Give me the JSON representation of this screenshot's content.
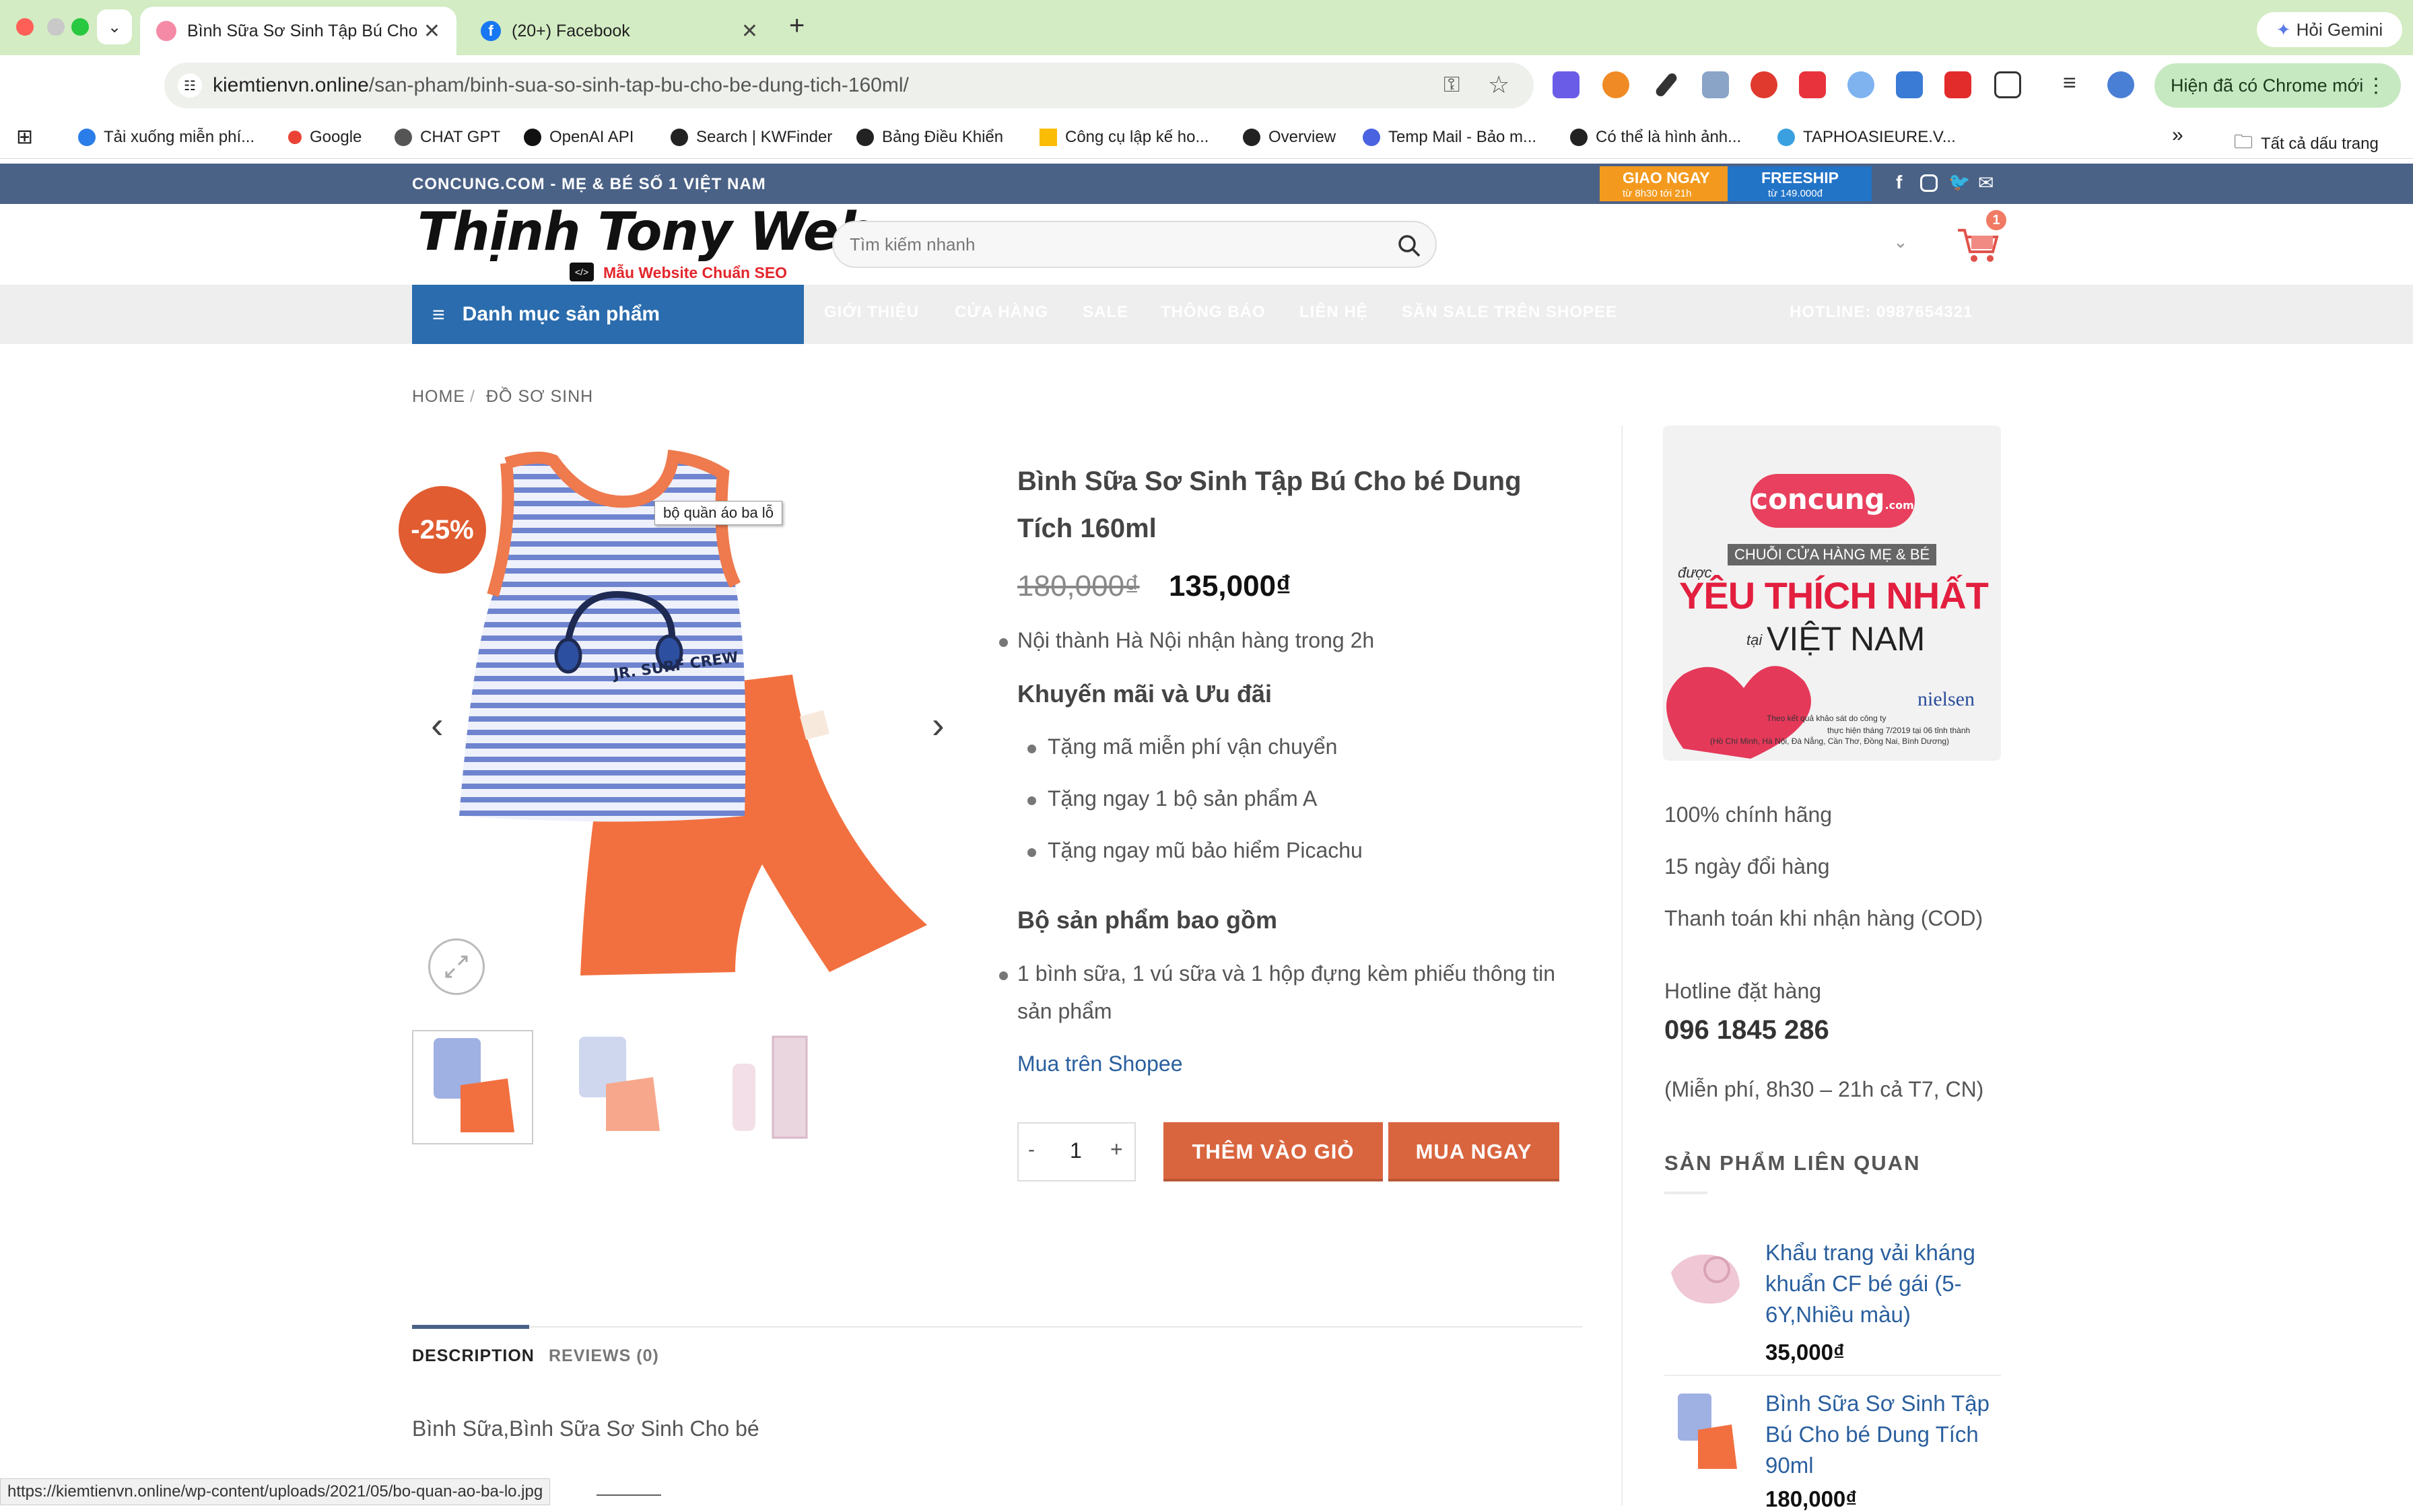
{
  "browser": {
    "tabs": [
      {
        "title": "Bình Sữa Sơ Sinh Tập Bú Cho",
        "active": true
      },
      {
        "title": "(20+) Facebook",
        "active": false
      }
    ],
    "new_tab": "+",
    "gemini_label": "Hỏi Gemini",
    "url_host": "kiemtienvn.online",
    "url_path": "/san-pham/binh-sua-so-sinh-tap-bu-cho-be-dung-tich-160ml/",
    "chrome_update_label": "Hiện đã có Chrome mới",
    "bookmarks": [
      {
        "label": "Tải xuống miễn phí...",
        "color": "#2b7de9"
      },
      {
        "label": "Google",
        "color": "#ea4335"
      },
      {
        "label": "CHAT GPT",
        "color": "#555555"
      },
      {
        "label": "OpenAI API",
        "color": "#111111"
      },
      {
        "label": "Search | KWFinder",
        "color": "#222222"
      },
      {
        "label": "Bảng Điều Khiển",
        "color": "#222222"
      },
      {
        "label": "Công cụ lập kế ho...",
        "color": "#fbbc05"
      },
      {
        "label": "Overview",
        "color": "#222222"
      },
      {
        "label": "Temp Mail - Bảo m...",
        "color": "#4a63e0"
      },
      {
        "label": "Có thể là hình ảnh...",
        "color": "#222222"
      },
      {
        "label": "TAPHOASIEURE.V...",
        "color": "#3aa0e0"
      }
    ],
    "bookmarks_more": "»",
    "all_bookmarks": "Tất cả dấu trang",
    "status_url": "https://kiemtienvn.online/wp-content/uploads/2021/05/bo-quan-ao-ba-lo.jpg"
  },
  "site": {
    "tagline": "CONCUNG.COM - MẸ & BÉ SỐ 1 VIỆT NAM",
    "promo1_title": "GIAO NGAY",
    "promo1_sub": "từ 8h30 tới 21h",
    "promo2_title": "FREESHIP",
    "promo2_sub": "từ 149.000đ",
    "logo_text": "Thịnh Tony Web",
    "logo_sub": "Mẫu Website Chuẩn SEO",
    "search_placeholder": "Tìm kiếm nhanh",
    "cart_count": "1",
    "category_button": "Danh mục sản phẩm",
    "nav": [
      "GIỚI THIỆU",
      "CỬA HÀNG",
      "SALE",
      "THÔNG BÁO",
      "LIÊN HỆ",
      "SĂN SALE TRÊN SHOPEE"
    ],
    "hotline_nav": "HOTLINE: 0987654321",
    "brand_color": "#2a6cad",
    "accent_color": "#d9653f"
  },
  "breadcrumb": {
    "home": "HOME",
    "sep": "/",
    "category": "ĐỒ SƠ SINH"
  },
  "product": {
    "sale_badge": "-25%",
    "image_tooltip": "bộ quần áo ba lỗ",
    "shirt_print": "JR. SURF CREW",
    "title": "Bình Sữa Sơ Sinh Tập Bú Cho bé Dung Tích 160ml",
    "old_price": "180,000₫",
    "price": "135,000₫",
    "delivery_note": "Nội thành Hà Nội nhận hàng trong 2h",
    "promo_heading": "Khuyến mãi và Ưu đãi",
    "promos": [
      "Tặng mã miễn phí vận chuyển",
      "Tặng ngay 1 bộ sản phẩm A",
      "Tặng ngay mũ bảo hiểm Picachu"
    ],
    "includes_heading": "Bộ sản phẩm bao gồm",
    "includes_line1": "1 bình sữa, 1 vú sữa và 1 hộp đựng kèm phiếu thông tin",
    "includes_line2": "sản phẩm",
    "shopee_link": "Mua trên Shopee",
    "qty_minus": "-",
    "qty": "1",
    "qty_plus": "+",
    "add_to_cart": "THÊM VÀO GIỎ",
    "buy_now": "MUA NGAY",
    "tabs": [
      "DESCRIPTION",
      "REVIEWS (0)"
    ],
    "description": "Bình Sữa,Bình Sữa Sơ Sinh Cho bé",
    "description_cut": "———"
  },
  "sidebar": {
    "banner_brand": "concung",
    "banner_brand_sub": ".com",
    "banner_chain": "CHUỖI CỬA HÀNG MẸ & BÉ",
    "banner_duoc": "được",
    "banner_love": "YÊU THÍCH NHẤT",
    "banner_tai": "tại",
    "banner_vn": "VIỆT NAM",
    "banner_nielsen": "nielsen",
    "banner_fine1": "Theo kết quả khảo sát do công ty",
    "banner_fine2": "thực hiện tháng 7/2019 tại 06 tỉnh thành",
    "banner_fine3": "(Hồ Chí Minh, Hà Nội, Đà Nẵng, Cần Thơ, Đồng Nai, Bình Dương)",
    "perks": [
      "100% chính hãng",
      "15 ngày đổi hàng",
      "Thanh toán khi nhận hàng (COD)"
    ],
    "hotline_label": "Hotline đặt hàng",
    "hotline_number": "096 1845 286",
    "hotline_note": "(Miễn phí, 8h30 – 21h cả T7, CN)",
    "related_heading": "SẢN PHẨM LIÊN QUAN",
    "related": [
      {
        "line1": "Khẩu trang vải kháng",
        "line2": "khuẩn CF bé gái (5-",
        "line3": "6Y,Nhiều màu)",
        "price": "35,000₫"
      },
      {
        "line1": "Bình Sữa Sơ Sinh Tập",
        "line2": "Bú Cho bé Dung Tích",
        "line3": "90ml",
        "price": "180,000₫"
      }
    ]
  }
}
